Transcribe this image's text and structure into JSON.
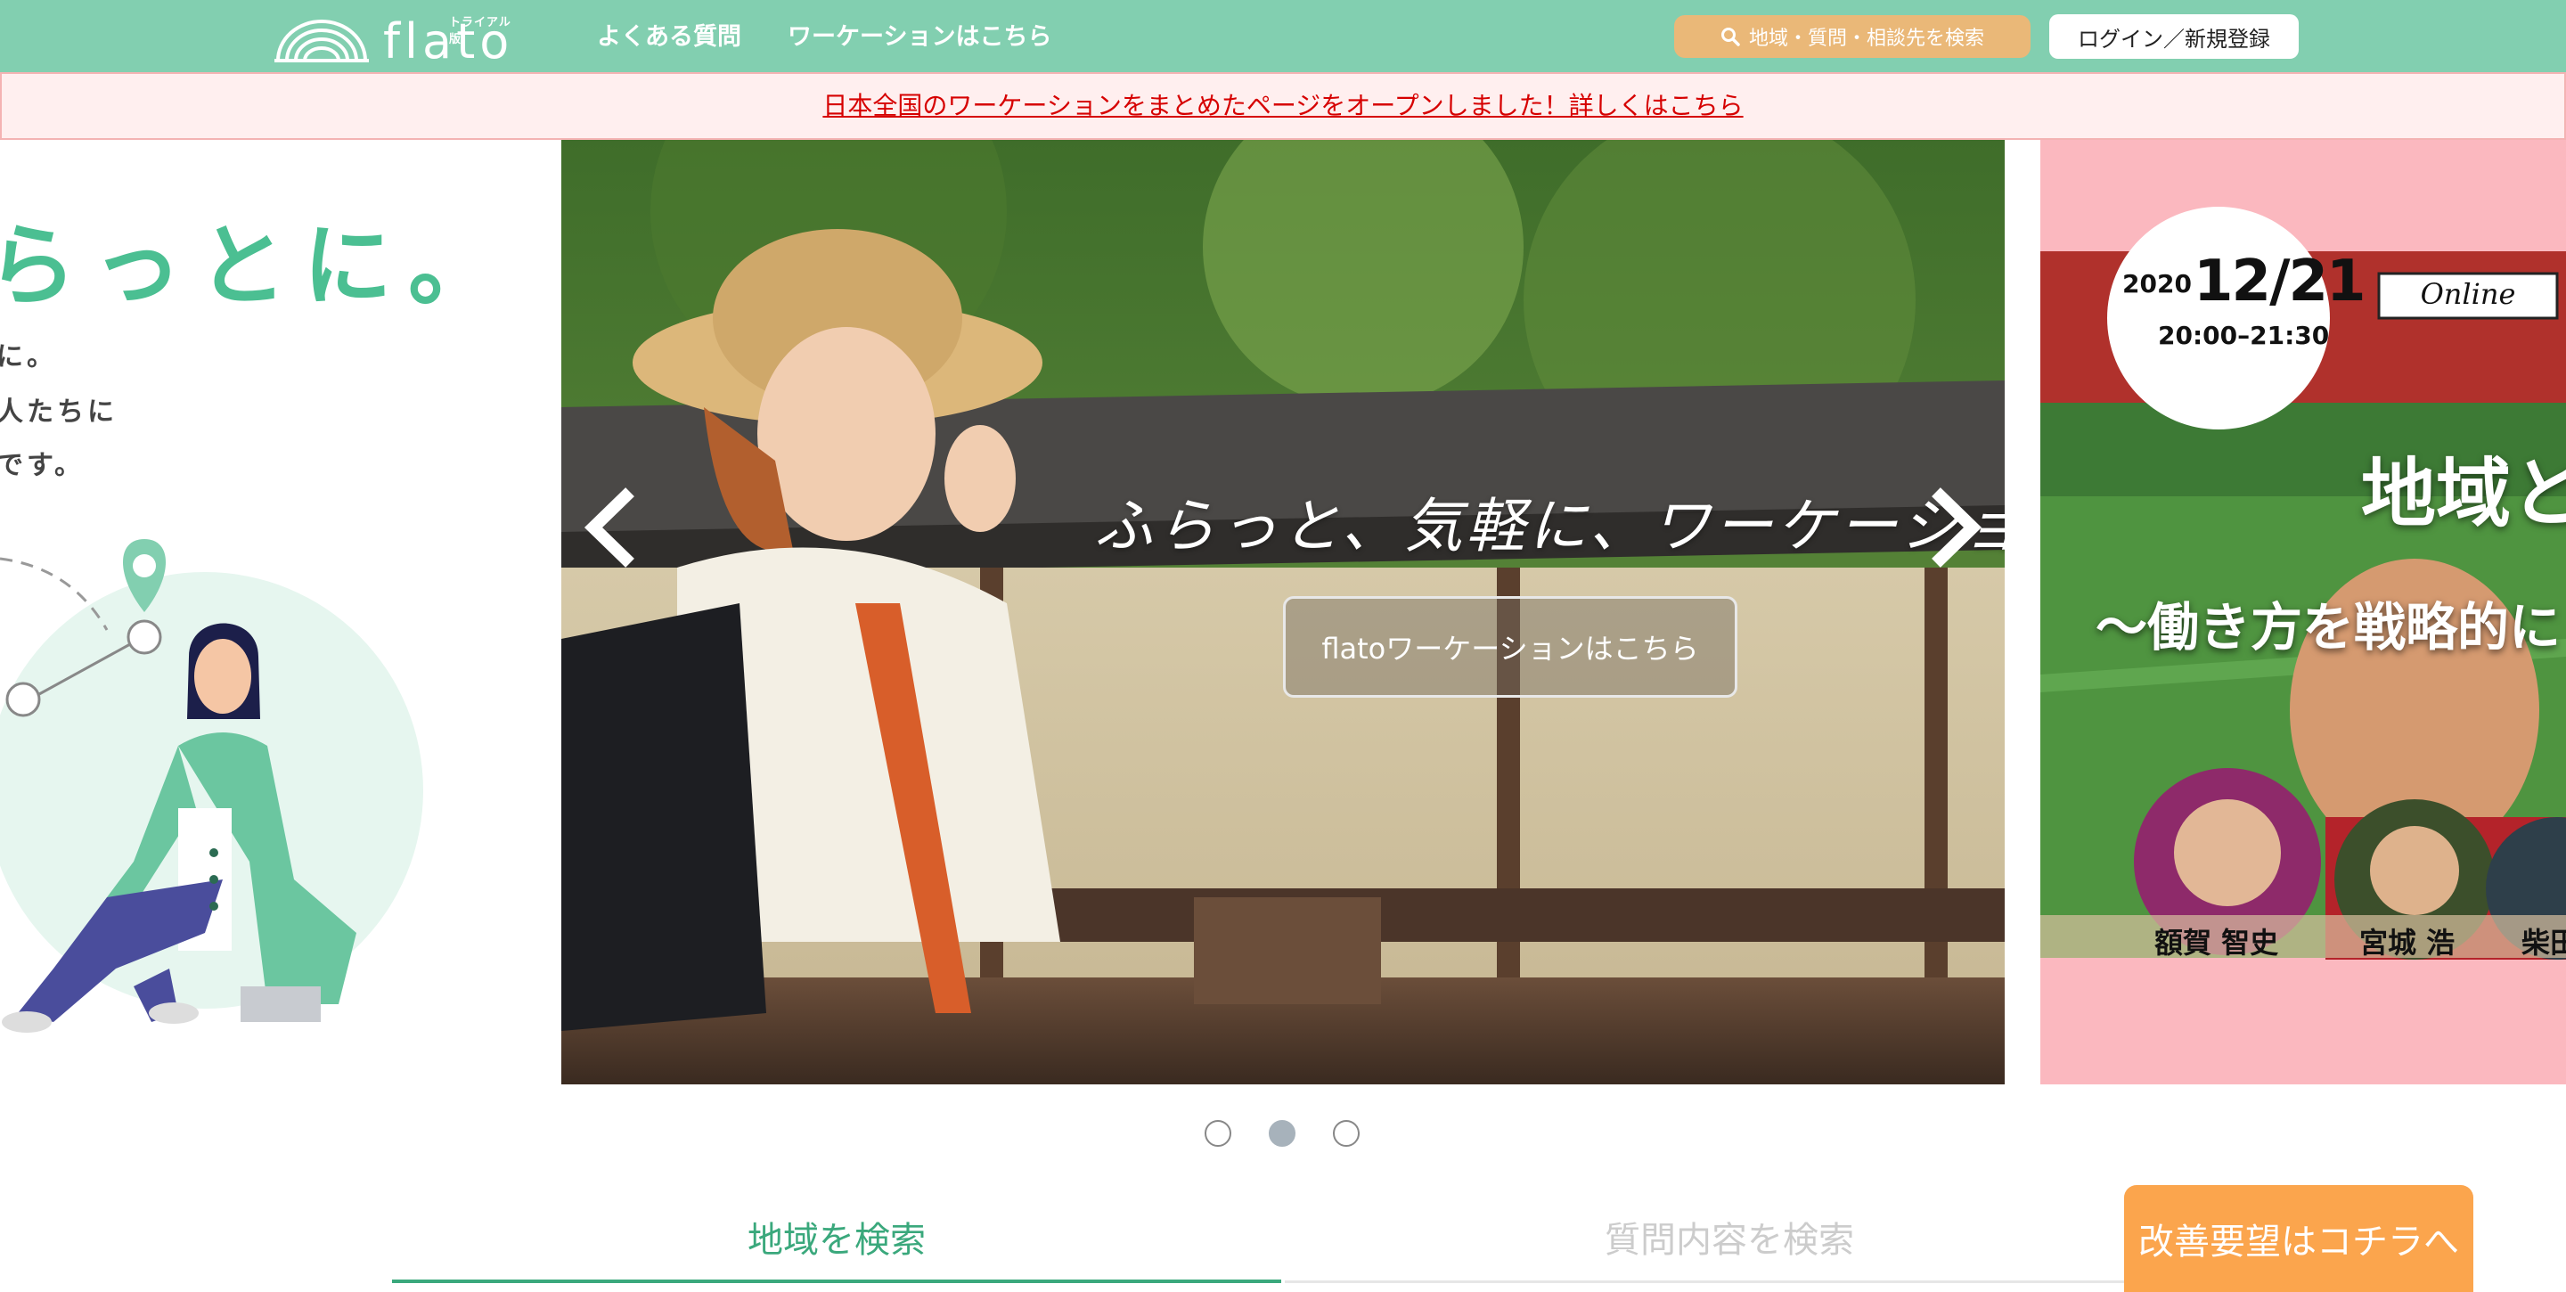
{
  "header": {
    "logo_word": "flato",
    "logo_tag": "トライアル版",
    "nav": [
      {
        "label": "よくある質問"
      },
      {
        "label": "ワーケーションはこちら"
      }
    ],
    "search_label": "地域・質問・相談先を検索",
    "login_label": "ログイン／新規登録"
  },
  "banner": {
    "text": "日本全国のワーケーションをまとめたページをオープンしました！詳しくはこちら"
  },
  "carousel": {
    "left_slide": {
      "title": "らっとに。",
      "lines": [
        "に。",
        "人たちに",
        "です。"
      ]
    },
    "center_slide": {
      "tagline": "ふらっと、気軽に、ワーケーション。",
      "cta_label": "flatoワーケーションはこちら"
    },
    "right_slide": {
      "year": "2020",
      "date": "12/21",
      "time": "20:00–21:30",
      "online_label": "Online",
      "headline": "地域と",
      "subheadline": "〜働き方を戦略的に",
      "speakers": [
        "額賀 智史",
        "宮城 浩",
        "柴田"
      ]
    },
    "dots_total": 3,
    "active_dot_index": 1
  },
  "tabs": [
    {
      "label": "地域を検索",
      "active": true
    },
    {
      "label": "質問内容を検索",
      "active": false
    }
  ],
  "improve_button_label": "改善要望はコチラへ",
  "colors": {
    "header": "#82cfb0",
    "accent_green": "#3aa87c",
    "search_orange": "#eab878",
    "banner_bg": "#ffefef",
    "banner_text": "#d60000",
    "improve_orange": "#fba54d"
  }
}
